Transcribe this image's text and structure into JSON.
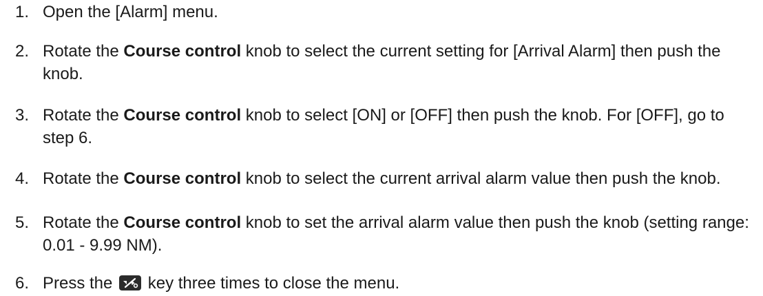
{
  "steps": [
    {
      "number": "1.",
      "text": "Open the [Alarm] menu."
    },
    {
      "number": "2.",
      "pre": "Rotate the ",
      "bold": "Course control",
      "post": " knob to select the current setting for [Arrival Alarm] then push the knob."
    },
    {
      "number": "3.",
      "pre": "Rotate the ",
      "bold": "Course control",
      "post": " knob to select [ON] or [OFF] then push the knob. For [OFF], go to step 6."
    },
    {
      "number": "4.",
      "pre": "Rotate the ",
      "bold": "Course control",
      "post": " knob to select the current arrival alarm value then push the knob."
    },
    {
      "number": "5.",
      "pre": "Rotate the ",
      "bold": "Course control",
      "post": " knob to set the arrival alarm value then push the knob (setting range: 0.01 - 9.99 NM)."
    },
    {
      "number": "6.",
      "pre": "Press the ",
      "icon": "menu-escape-key-icon",
      "post": " key three times to close the menu."
    }
  ],
  "colors": {
    "text": "#1a1a1a",
    "key_fill": "#2b2b2b",
    "key_symbol": "#ffffff"
  }
}
